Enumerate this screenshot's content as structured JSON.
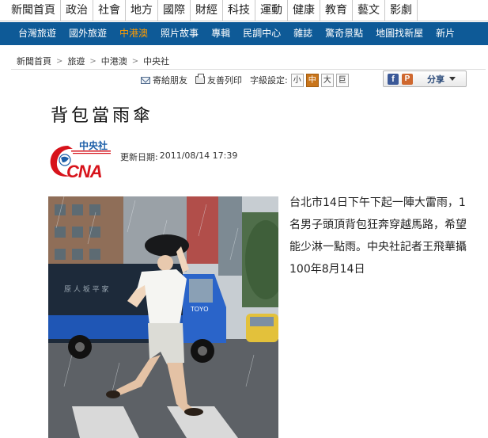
{
  "topnav": [
    "新聞首頁",
    "政治",
    "社會",
    "地方",
    "國際",
    "財經",
    "科技",
    "運動",
    "健康",
    "教育",
    "藝文",
    "影劇"
  ],
  "subnav": [
    {
      "label": "台灣旅遊",
      "active": false
    },
    {
      "label": "國外旅遊",
      "active": false
    },
    {
      "label": "中港澳",
      "active": true
    },
    {
      "label": "照片故事",
      "active": false
    },
    {
      "label": "專輯",
      "active": false
    },
    {
      "label": "民調中心",
      "active": false
    },
    {
      "label": "雜誌",
      "active": false
    },
    {
      "label": "驚奇景點",
      "active": false
    },
    {
      "label": "地圖找新屋",
      "active": false
    },
    {
      "label": "新片",
      "active": false
    }
  ],
  "breadcrumb": [
    "新聞首頁",
    "旅遊",
    "中港澳",
    "中央社"
  ],
  "tools": {
    "email_label": "寄給朋友",
    "print_label": "友善列印",
    "font_size_label": "字級設定:",
    "font_sizes": [
      "小",
      "中",
      "大",
      "巨"
    ],
    "active_font_size": "中",
    "share_label": "分享",
    "facebook_icon_text": "f",
    "plurk_icon_text": "P"
  },
  "article": {
    "title": "背包當雨傘",
    "source_logo": {
      "chinese": "中央社",
      "latin": "CNA"
    },
    "updated_label": "更新日期:",
    "updated_value": "2011/08/14 17:39",
    "caption": "台北市14日下午下起一陣大雷雨，1名男子頭頂背包狂奔穿越馬路，希望能少淋一點雨。中央社記者王飛華攝 100年8月14日"
  },
  "photo": {
    "truck_text": "TOYO",
    "truck_side_text": "原 人 坂 平 家"
  },
  "colors": {
    "subnav_bg": "#0e5a97",
    "subnav_active": "#ff9c00",
    "logo_red": "#d7131b",
    "logo_blue": "#1b5ea8"
  }
}
